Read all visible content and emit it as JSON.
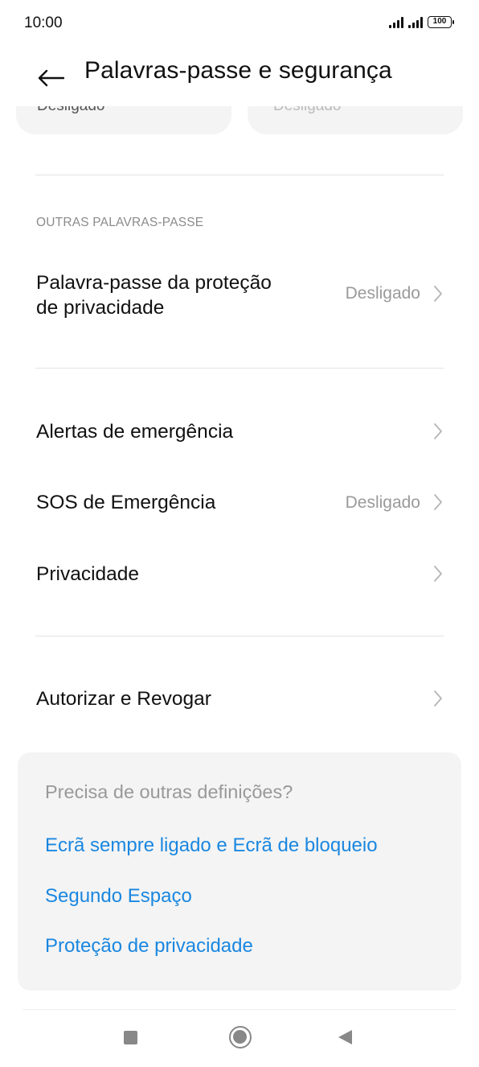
{
  "status_bar": {
    "time": "10:00",
    "battery": "100",
    "icons": [
      "signal-icon",
      "signal-icon",
      "battery-icon"
    ]
  },
  "header": {
    "back_icon": "back-arrow-icon",
    "title": "Palavras-passe e segurança"
  },
  "scrolled_cards": {
    "left_value": "Desligado",
    "right_value": "Desligado"
  },
  "other_passwords": {
    "section_title": "OUTRAS PALAVRAS-PASSE",
    "privacy_password": {
      "label_line1": "Palavra-passe da proteção",
      "label_line2": "de privacidade",
      "value": "Desligado"
    }
  },
  "items": {
    "emergency_alerts": {
      "label": "Alertas de emergência",
      "value": ""
    },
    "emergency_sos": {
      "label": "SOS de Emergência",
      "value": "Desligado"
    },
    "privacy": {
      "label": "Privacidade",
      "value": ""
    },
    "authorize_revoke": {
      "label": "Autorizar e Revogar",
      "value": ""
    }
  },
  "suggestions": {
    "title": "Precisa de outras definições?",
    "links": [
      "Ecrã sempre ligado e Ecrã de bloqueio",
      "Segundo Espaço",
      "Proteção de privacidade"
    ]
  },
  "nav_bar": {
    "icons": [
      "recents-square-icon",
      "home-circle-icon",
      "back-triangle-icon"
    ]
  },
  "colors": {
    "accent": "#1a87e0",
    "secondary_text": "#9a9a9a",
    "card_bg": "#f4f4f4",
    "divider": "#e3e3e3"
  }
}
